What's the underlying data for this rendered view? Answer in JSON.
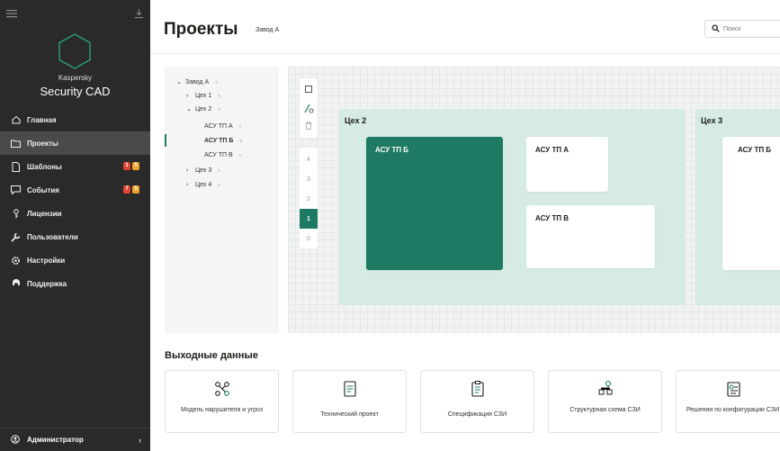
{
  "colors": {
    "accent": "#1e7a63",
    "sidebar_bg": "#2a2a2a",
    "zone_bg": "#d5ebe4",
    "badge_red": "#e2432f",
    "badge_orange": "#f0a229"
  },
  "sidebar": {
    "brand_small": "Kaspersky",
    "brand_big": "Security CAD",
    "items": [
      {
        "label": "Главная",
        "icon": "home-icon"
      },
      {
        "label": "Проекты",
        "icon": "folder-icon",
        "active": true
      },
      {
        "label": "Шаблоны",
        "icon": "document-icon",
        "badges": [
          "1",
          "5"
        ]
      },
      {
        "label": "События",
        "icon": "chat-icon",
        "badges": [
          "7",
          "5"
        ]
      },
      {
        "label": "Лицензии",
        "icon": "key-icon"
      },
      {
        "label": "Пользователи",
        "icon": "wrench-icon"
      },
      {
        "label": "Настройки",
        "icon": "gear-icon"
      },
      {
        "label": "Поддержка",
        "icon": "support-icon"
      }
    ],
    "footer_label": "Администратор"
  },
  "header": {
    "title": "Проекты",
    "subtitle": "Завод А",
    "search_placeholder": "Поиск"
  },
  "tree": {
    "items": [
      {
        "label": "Завод А",
        "caret": "⌄"
      },
      {
        "label": "Цех 1",
        "caret": "›"
      },
      {
        "label": "Цех 2",
        "caret": "⌄"
      },
      {
        "label": "АСУ ТП А",
        "caret": ""
      },
      {
        "label": "АСУ ТП Б",
        "caret": "",
        "selected": true
      },
      {
        "label": "АСУ ТП В",
        "caret": ""
      },
      {
        "label": "Цех 3",
        "caret": "›"
      },
      {
        "label": "Цех 4",
        "caret": "›"
      }
    ]
  },
  "canvas": {
    "levels": [
      "4",
      "3",
      "2",
      "1",
      "0"
    ],
    "active_level": "1",
    "zones": [
      {
        "title": "Цех 2"
      },
      {
        "title": "Цех 3"
      }
    ],
    "cards": {
      "z2_card1": "АСУ ТП Б",
      "z2_card2": "АСУ ТП А",
      "z2_card3": "АСУ ТП В",
      "z3_card1": "АСУ ТП Б"
    }
  },
  "output": {
    "title": "Выходные данные",
    "cards": [
      {
        "label": "Модель нарушителя и угроз",
        "icon": "graph-icon"
      },
      {
        "label": "Технический проект",
        "icon": "doc-lines-icon"
      },
      {
        "label": "Спецификация СЗИ",
        "icon": "clipboard-icon"
      },
      {
        "label": "Структурная схема СЗИ",
        "icon": "scheme-icon"
      },
      {
        "label": "Решения по конфигурации СЗИ",
        "icon": "settings-doc-icon"
      }
    ]
  }
}
